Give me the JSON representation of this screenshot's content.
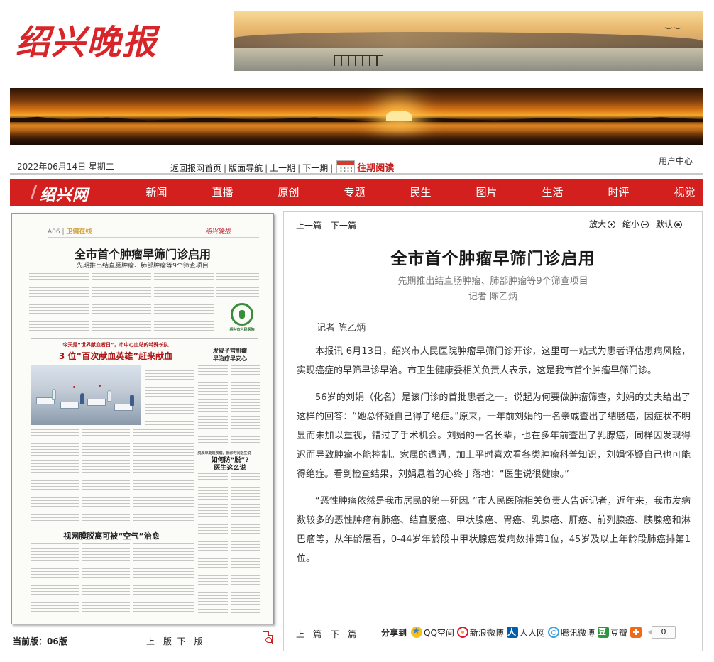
{
  "masthead": {
    "logo_text": "绍兴晚报"
  },
  "topbar": {
    "date": "2022年06月14日 星期二",
    "links": [
      "返回报网首页",
      "版面导航",
      "上一期",
      "下一期"
    ],
    "past_issues": "往期阅读",
    "user_center": "用户中心"
  },
  "nav": {
    "site_name": "绍兴网",
    "items": [
      "新闻",
      "直播",
      "原创",
      "专题",
      "民生",
      "图片",
      "生活",
      "时评",
      "视觉"
    ],
    "background": "#d41f1f"
  },
  "paper": {
    "section": "A06",
    "section_name": "卫健在线",
    "brand": "绍兴晚报",
    "headline": "全市首个肿瘤早筛门诊启用",
    "subhead": "先期推出结直肠肿瘤、肺部肿瘤等9个筛查项目",
    "kicker2": "今天是“世界献血者日”，市中心血站的特殊长队",
    "headline2": "3 位“百次献血英雄”赶来献血",
    "headline3a": "发现子宫肌瘤",
    "headline3b": "早治疗早安心",
    "kicker4": "脱发早期是疾病，就诊时间医生说",
    "headline4a": "如何防“脱”?",
    "headline4b": "医生这么说",
    "headline5": "视网膜脱离可被“空气”治愈",
    "logo_label": "绍兴市人民医院",
    "current_edition_label": "当前版：",
    "current_edition": "06版",
    "prev_page": "上一版",
    "next_page": "下一版"
  },
  "article": {
    "prev": "上一篇",
    "next": "下一篇",
    "zoom_in": "放大",
    "zoom_out": "缩小",
    "zoom_default": "默认",
    "title": "全市首个肿瘤早筛门诊启用",
    "subtitle": "先期推出结直肠肿瘤、肺部肿瘤等9个筛查项目",
    "author": "记者 陈乙炳",
    "byline": "记者 陈乙炳",
    "paragraphs": [
      "本报讯 6月13日，绍兴市人民医院肿瘤早筛门诊开诊，这里可一站式为患者评估患病风险，实现癌症的早筛早诊早治。市卫生健康委相关负责人表示，这是我市首个肿瘤早筛门诊。",
      "56岁的刘娟（化名）是该门诊的首批患者之一。说起为何要做肿瘤筛查，刘娟的丈夫给出了这样的回答：“她总怀疑自己得了绝症。”原来，一年前刘娟的一名亲戚查出了结肠癌，因症状不明显而未加以重视，错过了手术机会。刘娟的一名长辈，也在多年前查出了乳腺癌，同样因发现得迟而导致肿瘤不能控制。家属的遭遇，加上平时喜欢看各类肿瘤科普知识，刘娟怀疑自己也可能得绝症。看到检查结果，刘娟悬着的心终于落地：“医生说很健康。”",
      "“恶性肿瘤依然是我市居民的第一死因。”市人民医院相关负责人告诉记者，近年来，我市发病数较多的恶性肿瘤有肺癌、结直肠癌、甲状腺癌、胃癌、乳腺癌、肝癌、前列腺癌、胰腺癌和淋巴瘤等，从年龄层看，0-44岁年龄段中甲状腺癌发病数排第1位，45岁及以上年龄段肺癌排第1位。"
    ],
    "share_label": "分享到",
    "share_items": [
      "QQ空间",
      "新浪微博",
      "人人网",
      "腾讯微博",
      "豆瓣"
    ],
    "share_count": "0"
  }
}
